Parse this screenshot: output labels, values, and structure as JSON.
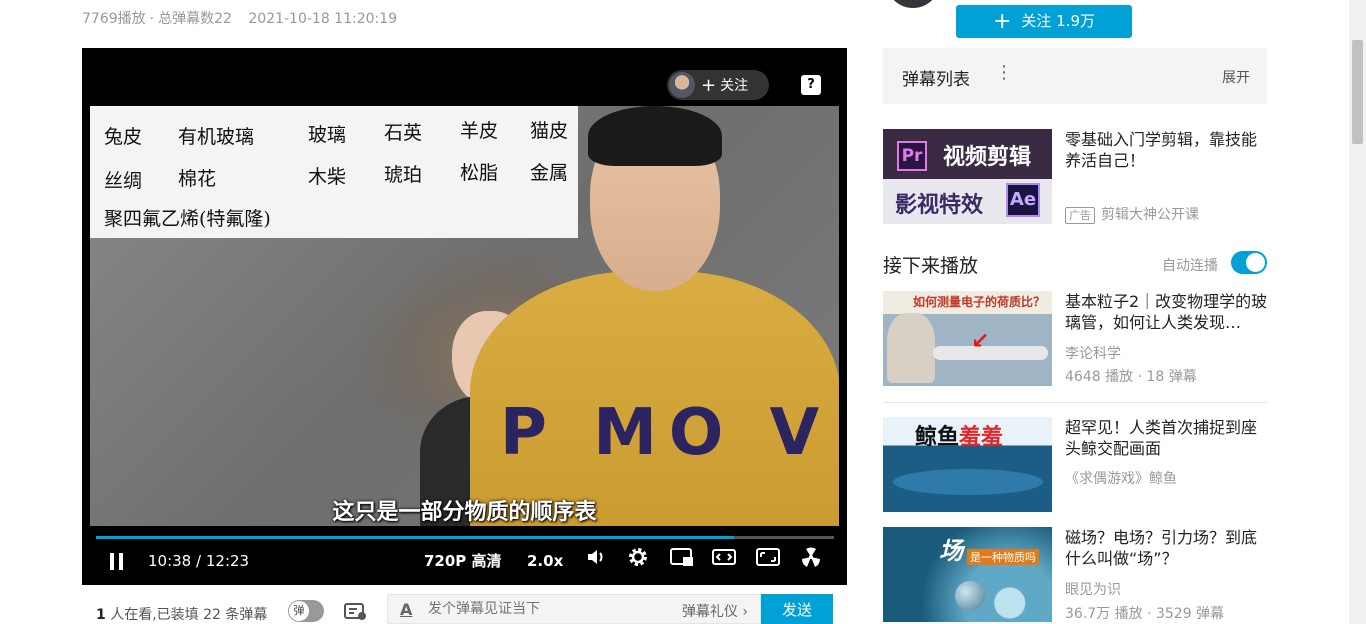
{
  "meta": {
    "plays": "7769播放",
    "danmaku_total": "总弹幕数22",
    "date": "2021-10-18 11:20:19"
  },
  "player": {
    "follow_label": "关注",
    "help_label": "?",
    "periodic_table": [
      "兔皮",
      "有机玻璃",
      "玻璃",
      "石英",
      "羊皮",
      "猫皮",
      "丝绸",
      "棉花",
      "木柴",
      "琥珀",
      "松脂",
      "金属",
      "聚四氟乙烯(特氟隆)"
    ],
    "shirt_text": "P MO V",
    "subtitle": "这只是一部分物质的顺序表",
    "progress": 0.865,
    "current_time": "10:38",
    "time_sep": "/",
    "duration": "12:23",
    "quality": "720P 高清",
    "speed": "2.0x"
  },
  "below_player": {
    "viewers_count": "1",
    "viewers_text": " 人在看,已装填 22 条弹幕",
    "danmaku_toggle_label": "弹",
    "input_placeholder": "发个弹幕见证当下",
    "etiquette_label": "弹幕礼仪 ›",
    "send_label": "发送"
  },
  "sidebar": {
    "follow_button": "关注 1.9万",
    "danmaku_list_title": "弹幕列表",
    "danmaku_list_expand": "展开",
    "ad": {
      "thumb_text_1": "视频剪辑",
      "thumb_text_2": "影视特效",
      "thumb_pr": "Pr",
      "thumb_ae": "Ae",
      "title": "零基础入门学剪辑，靠技能养活自己！",
      "badge": "广告",
      "source": "剪辑大神公开课"
    },
    "next_heading": "接下来播放",
    "autoplay_label": "自动连播",
    "autoplay_on": true,
    "recommendations": [
      {
        "thumb_caption": "如何测量电子的荷质比？",
        "title": "基本粒子2｜改变物理学的玻璃管，如何让人类发现…",
        "author": "李论科学",
        "stats": "4648 播放 · 18 弹幕"
      },
      {
        "thumb_caption_a": "鲸鱼",
        "thumb_caption_b": "羞羞",
        "title": "超罕见！人类首次捕捉到座头鲸交配画面",
        "author": "《求偶游戏》鲸鱼"
      },
      {
        "thumb_caption": "场",
        "thumb_caption_2": "是一种物质吗",
        "title": "磁场？电场？引力场？到底什么叫做“场”？",
        "author": "眼见为识",
        "stats": "36.7万 播放 · 3529 弹幕"
      }
    ]
  },
  "colors": {
    "accent": "#00a1d6"
  }
}
